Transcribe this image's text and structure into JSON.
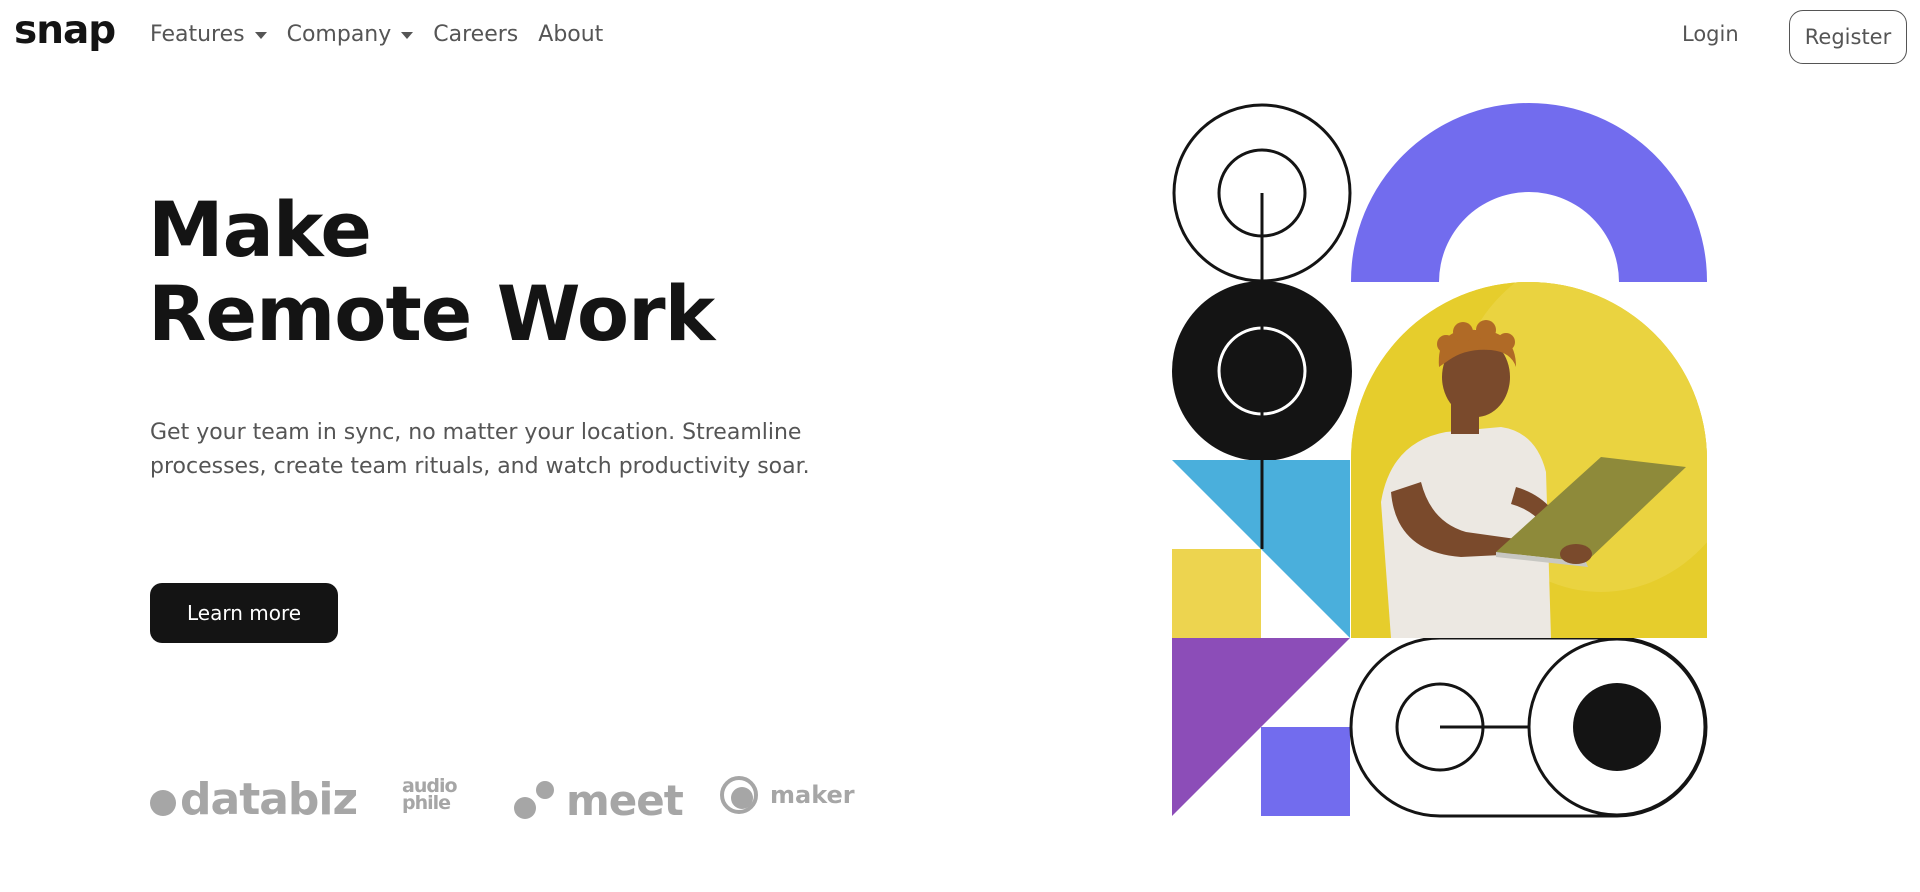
{
  "nav": {
    "logo": "snap",
    "links": [
      {
        "label": "Features",
        "has_dropdown": true
      },
      {
        "label": "Company",
        "has_dropdown": true
      },
      {
        "label": "Careers",
        "has_dropdown": false
      },
      {
        "label": "About",
        "has_dropdown": false
      }
    ],
    "login_label": "Login",
    "register_label": "Register"
  },
  "hero": {
    "title_line1": "Make",
    "title_line2": "Remote Work",
    "description": "Get your team in sync, no matter your location. Streamline processes, create team rituals, and watch productivity soar.",
    "cta_label": "Learn more"
  },
  "clients": {
    "databiz": "databiz",
    "audiophile_line1": "audio",
    "audiophile_line2": "phile",
    "meet": "meet",
    "maker": "maker"
  },
  "colors": {
    "text_dark": "#141414",
    "text_muted": "#555555",
    "logo_gray": "#a6a6a6",
    "violet": "#726cee",
    "yellow": "#edd44f",
    "sky": "#4aafdc",
    "purple": "#8c4db8",
    "photo_bg": "#e6cd2c"
  },
  "icons": [
    "chevron-down-icon",
    "maker-logo-icon"
  ]
}
